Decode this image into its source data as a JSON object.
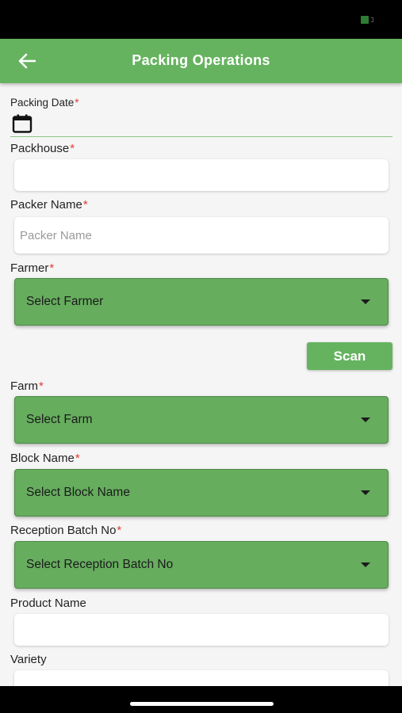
{
  "header": {
    "title": "Packing Operations"
  },
  "fields": {
    "packing_date": {
      "label": "Packing Date",
      "required": "*"
    },
    "packhouse": {
      "label": "Packhouse",
      "required": "*",
      "value": ""
    },
    "packer_name": {
      "label": "Packer Name",
      "required": "*",
      "placeholder": "Packer Name"
    },
    "farmer": {
      "label": "Farmer",
      "required": "*",
      "value": "Select Farmer"
    },
    "farm": {
      "label": "Farm",
      "required": "*",
      "value": "Select Farm"
    },
    "block_name": {
      "label": "Block Name",
      "required": "*",
      "value": "Select Block Name"
    },
    "reception_batch_no": {
      "label": "Reception Batch No",
      "required": "*",
      "value": "Select Reception Batch No"
    },
    "product_name": {
      "label": "Product Name",
      "value": ""
    },
    "variety": {
      "label": "Variety",
      "value": ""
    }
  },
  "actions": {
    "scan_label": "Scan"
  },
  "icons": {
    "back": "back-arrow-icon",
    "calendar": "calendar-icon",
    "caret": "caret-down-icon",
    "battery": "battery-icon"
  },
  "colors": {
    "primary": "#66b35f",
    "required": "#e53935",
    "dropdown_bg": "#66ad5e"
  }
}
